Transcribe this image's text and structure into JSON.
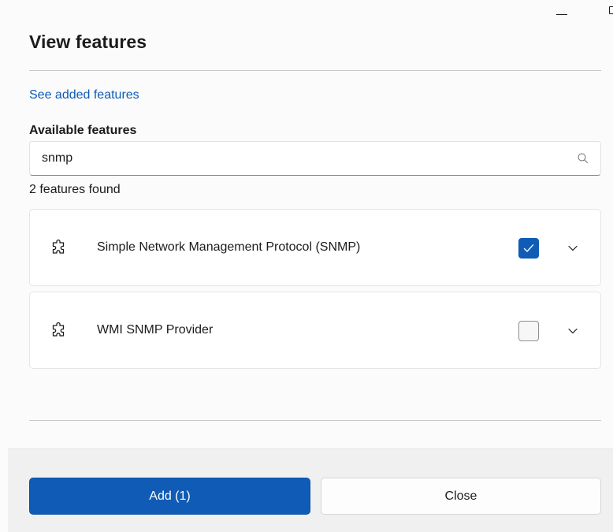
{
  "window": {
    "minimize_icon": "minimize-icon",
    "maximize_icon": "maximize-icon"
  },
  "header": {
    "title": "View features"
  },
  "links": {
    "see_added": "See added features"
  },
  "search": {
    "section_label": "Available features",
    "value": "snmp",
    "placeholder": "",
    "icon": "search-icon"
  },
  "results": {
    "count_text": "2 features found",
    "items": [
      {
        "name": "Simple Network Management Protocol (SNMP)",
        "icon": "puzzle-piece-icon",
        "checked": true
      },
      {
        "name": "WMI SNMP Provider",
        "icon": "puzzle-piece-icon",
        "checked": false
      }
    ]
  },
  "footer": {
    "add_label": "Add (1)",
    "close_label": "Close"
  },
  "colors": {
    "accent": "#0f5bb5",
    "link": "#0f5bb5",
    "text": "#1b1b1b",
    "footer_bg": "#f0f0f0"
  }
}
